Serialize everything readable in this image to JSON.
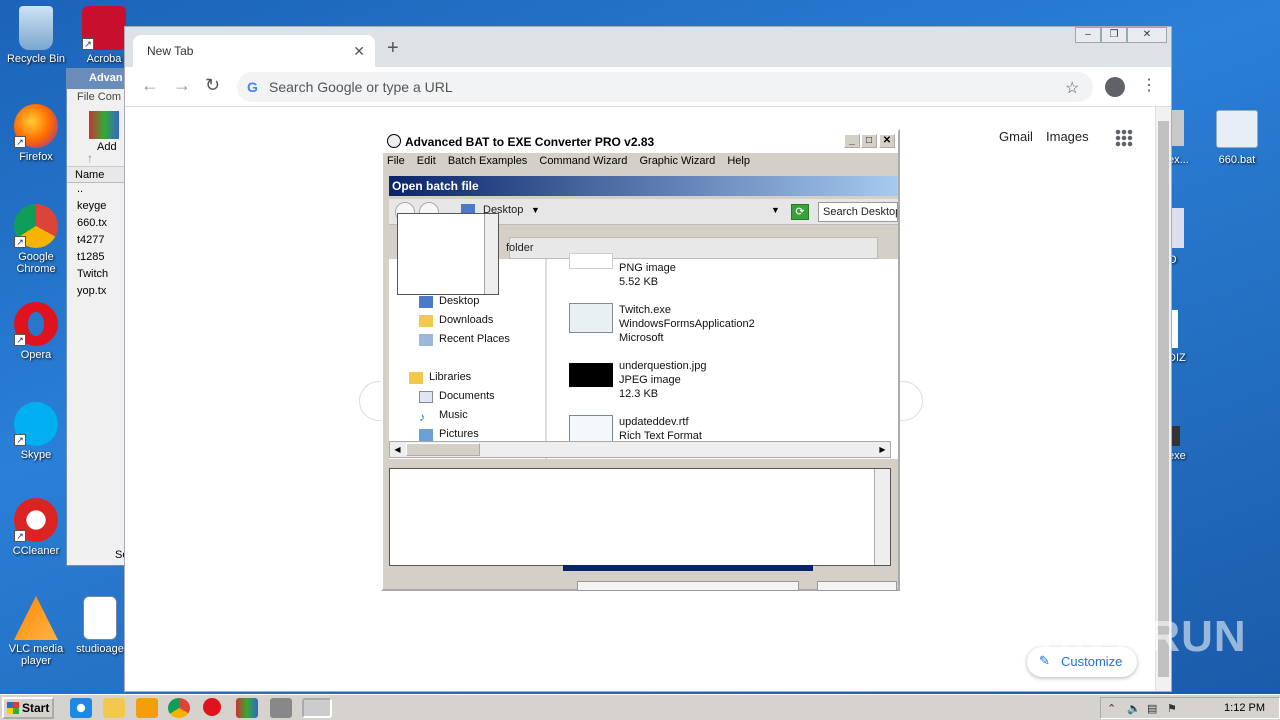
{
  "desktop_icons": [
    {
      "label": "Recycle Bin"
    },
    {
      "label": "Acroba"
    },
    {
      "label": "Firefox"
    },
    {
      "label": "Google Chrome"
    },
    {
      "label": "Opera"
    },
    {
      "label": "Skype"
    },
    {
      "label": "CCleaner"
    },
    {
      "label": "VLC media player"
    },
    {
      "label": "studioage"
    }
  ],
  "right_icons": [
    {
      "label": "ex..."
    },
    {
      "label": "660.bat"
    },
    {
      "label": "O"
    },
    {
      "label": "DIZ"
    },
    {
      "label": "exe"
    }
  ],
  "winrar": {
    "title": "Advan",
    "menu": "File  Com",
    "add_label": "Add",
    "col_name": "Name",
    "files": [
      "..",
      "keyge",
      "660.tx",
      "t4277",
      "t1285",
      "Twitch",
      "yop.tx"
    ],
    "status": "Se"
  },
  "chrome": {
    "tab_title": "New Tab",
    "omnibox_placeholder": "Search Google or type a URL",
    "links": {
      "gmail": "Gmail",
      "images": "Images"
    },
    "customize": "Customize"
  },
  "bat": {
    "title": "Advanced BAT to EXE Converter PRO v2.83",
    "menu": [
      "File",
      "Edit",
      "Batch Examples",
      "Command Wizard",
      "Graphic Wizard",
      "Help"
    ],
    "open_header": "Open batch file",
    "location": "Desktop",
    "search_placeholder": "Search Desktop",
    "col_header": "folder",
    "nav": [
      {
        "label": "Desktop"
      },
      {
        "label": "Downloads"
      },
      {
        "label": "Recent Places"
      },
      {
        "label": "Libraries"
      },
      {
        "label": "Documents"
      },
      {
        "label": "Music"
      },
      {
        "label": "Pictures"
      }
    ],
    "files": [
      {
        "l1": "PNG image",
        "l2": "5.52 KB",
        "l3": ""
      },
      {
        "l1": "Twitch.exe",
        "l2": "WindowsFormsApplication2",
        "l3": "Microsoft"
      },
      {
        "l1": "underquestion.jpg",
        "l2": "JPEG image",
        "l3": "12.3 KB"
      },
      {
        "l1": "updateddev.rtf",
        "l2": "Rich Text Format",
        "l3": ""
      }
    ]
  },
  "taskbar": {
    "start": "Start",
    "clock": "1:12 PM"
  },
  "watermark": "ANY RUN"
}
